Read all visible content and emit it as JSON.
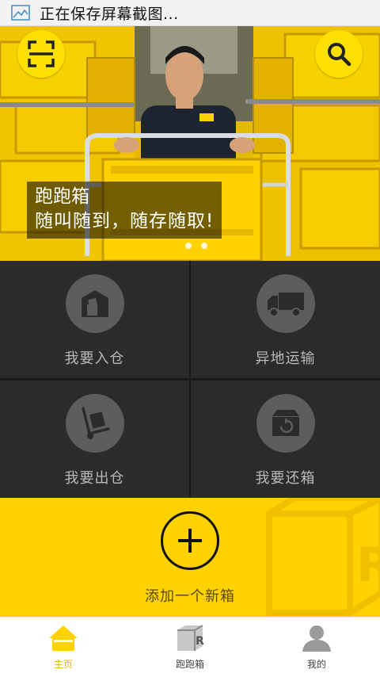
{
  "status_bar": {
    "icon": "screenshot-icon",
    "text": "正在保存屏幕截图..."
  },
  "hero": {
    "scan_icon": "scan-icon",
    "search_icon": "search-icon",
    "caption_line1": "跑跑箱",
    "caption_line2": "随叫随到，随存随取!",
    "active_slide": 1,
    "slide_count": 2
  },
  "actions": [
    {
      "label": "我要入仓",
      "icon": "warehouse-in-icon"
    },
    {
      "label": "异地运输",
      "icon": "truck-icon"
    },
    {
      "label": "我要出仓",
      "icon": "hand-truck-icon"
    },
    {
      "label": "我要还箱",
      "icon": "return-box-icon"
    }
  ],
  "add_box": {
    "label": "添加一个新箱",
    "icon": "plus-icon"
  },
  "tabs": [
    {
      "label": "主页",
      "icon": "home-icon",
      "active": true
    },
    {
      "label": "跑跑箱",
      "icon": "box-r-icon",
      "active": false
    },
    {
      "label": "我的",
      "icon": "user-icon",
      "active": false
    }
  ],
  "colors": {
    "brand_yellow": "#ffd200",
    "tile_dark": "#2b2b2b",
    "icon_circle": "#5d5d5d",
    "active_tab": "#e0b400"
  }
}
